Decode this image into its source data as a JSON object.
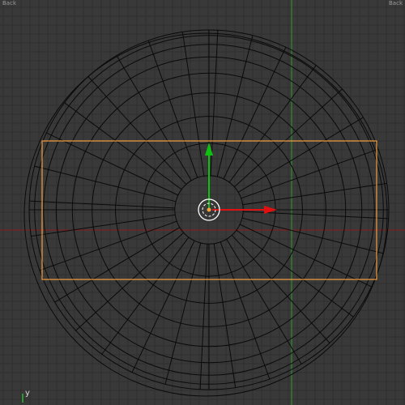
{
  "viewport": {
    "corner_labels": {
      "top_left": "Back",
      "top_right": "Back"
    },
    "axis_gizmo": {
      "y_label": "y"
    },
    "colors": {
      "background": "#393939",
      "grid": "#303030",
      "wire": "#0a0a0a",
      "selection": "#f5a040",
      "x_axis": "#8a1a1a",
      "y_axis": "#2a9a2a",
      "manip_x": "#e01010",
      "manip_y": "#10c010",
      "pivot": "#ffffff",
      "pivot_dot": "#f0a040"
    }
  }
}
